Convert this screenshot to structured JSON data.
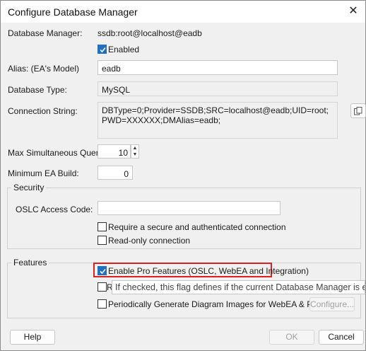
{
  "window": {
    "title": "Configure Database Manager",
    "close_glyph": "✕"
  },
  "form": {
    "db_manager_label": "Database Manager:",
    "db_manager_value": "ssdb:root@localhost@eadb",
    "enabled_label": "Enabled",
    "alias_label": "Alias: (EA's Model)",
    "alias_value": "eadb",
    "db_type_label": "Database Type:",
    "db_type_value": "MySQL",
    "conn_label": "Connection String:",
    "conn_value": "DBType=0;Provider=SSDB;SRC=localhost@eadb;UID=root;PWD=XXXXXX;DMAlias=eadb;",
    "max_queries_label": "Max Simultaneous Queries:",
    "max_queries_value": "10",
    "min_build_label": "Minimum EA Build:",
    "min_build_value": "0"
  },
  "security": {
    "title": "Security",
    "oslc_label": "OSLC Access Code:",
    "oslc_value": "",
    "require_secure_label": "Require a secure and authenticated connection",
    "readonly_label": "Read-only connection"
  },
  "features": {
    "title": "Features",
    "enable_pro_label": "Enable Pro Features (OSLC, WebEA and Integration)",
    "partial_label": "R",
    "tooltip": "If checked, this flag defines if the current Database Manager is enabled f",
    "periodic_label": "Periodically Generate Diagram Images for WebEA & Prolaborate",
    "configure_label": "Configure..."
  },
  "buttons": {
    "help": "Help",
    "ok": "OK",
    "cancel": "Cancel"
  },
  "colors": {
    "accent": "#1f6fc5",
    "highlight_box": "#e02020"
  },
  "checkbox_states": {
    "enabled": true,
    "require_secure": false,
    "readonly": false,
    "enable_pro": true,
    "r_option": false,
    "periodic": false
  }
}
